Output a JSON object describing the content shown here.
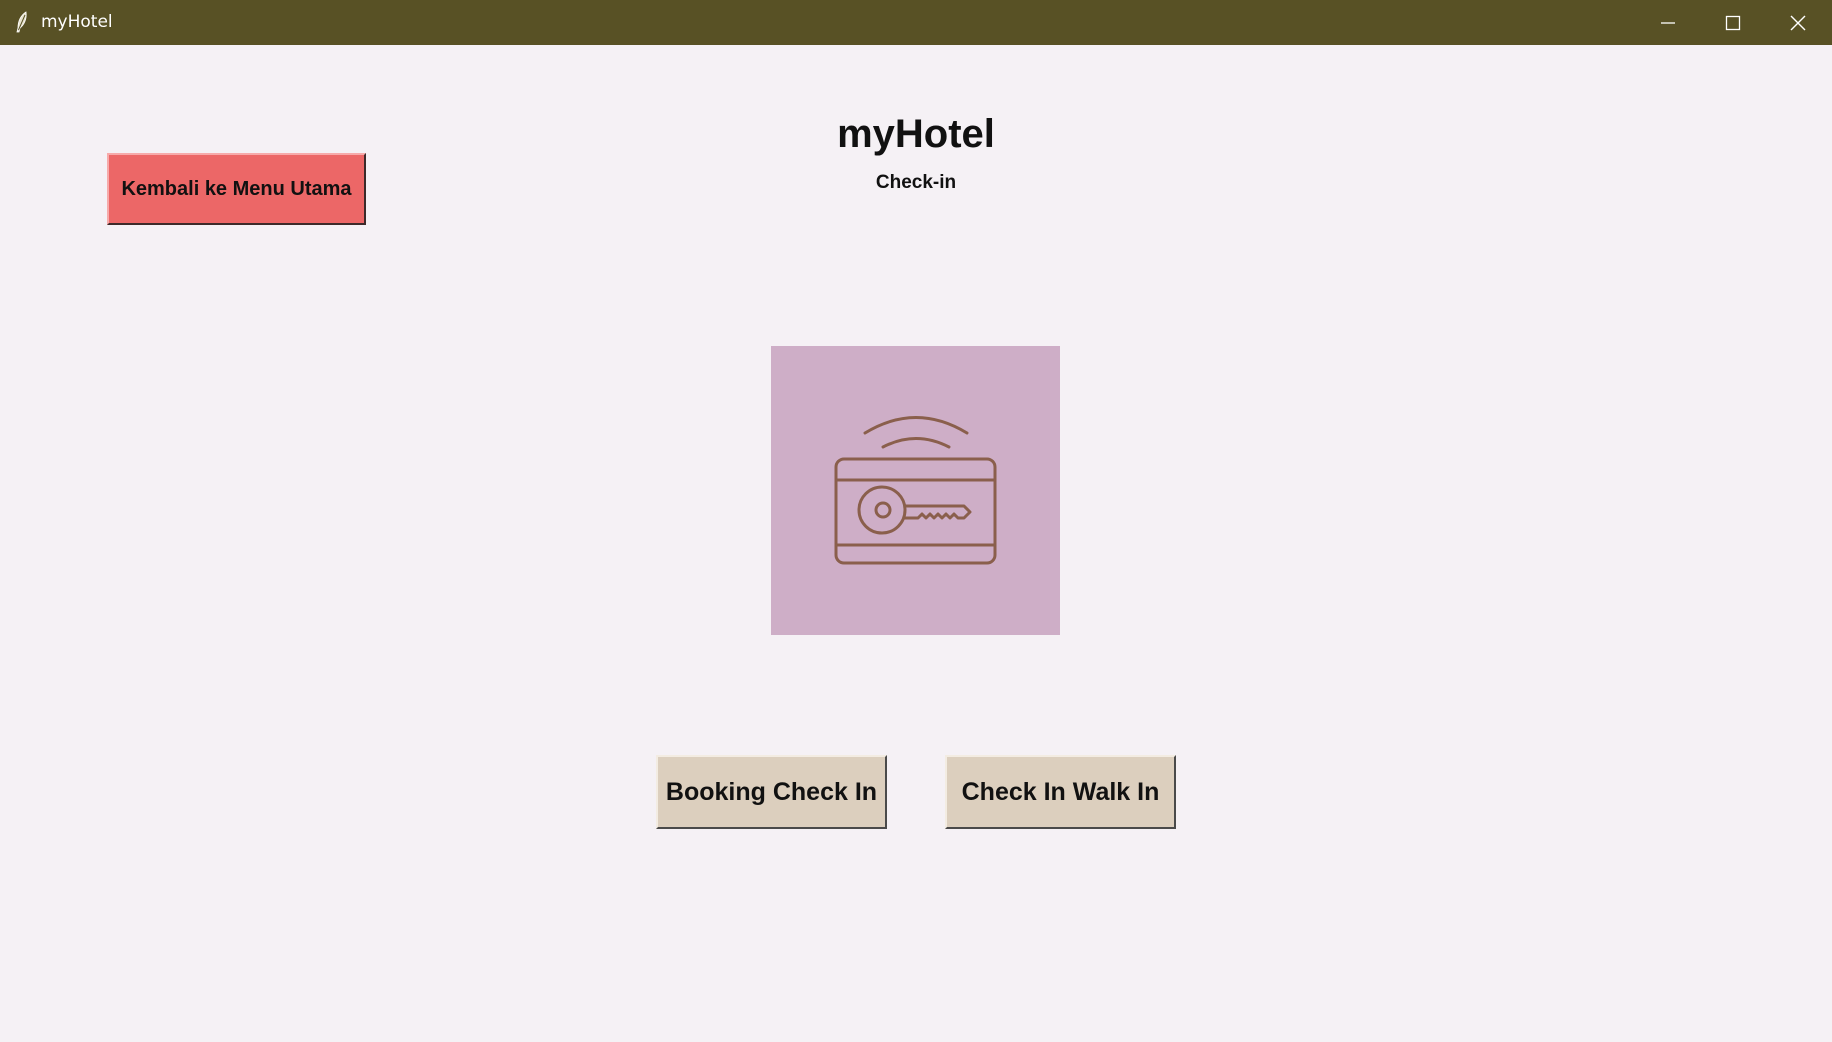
{
  "window": {
    "title": "myHotel",
    "controls": [
      "minimize-icon",
      "maximize-icon",
      "close-icon"
    ]
  },
  "header": {
    "title": "myHotel",
    "subtitle": "Check-in"
  },
  "buttons": {
    "back_label": "Kembali ke Menu Utama",
    "booking_label": "Booking Check In",
    "walkin_label": "Check In Walk In"
  },
  "illustration": {
    "icon": "key-card-icon"
  },
  "colors": {
    "titlebar": "#585125",
    "background": "#f5f1f5",
    "back_button": "#ec6767",
    "action_button": "#dccfbe",
    "illustration_bg": "#ceaec7",
    "illustration_stroke": "#8a5f4c"
  }
}
